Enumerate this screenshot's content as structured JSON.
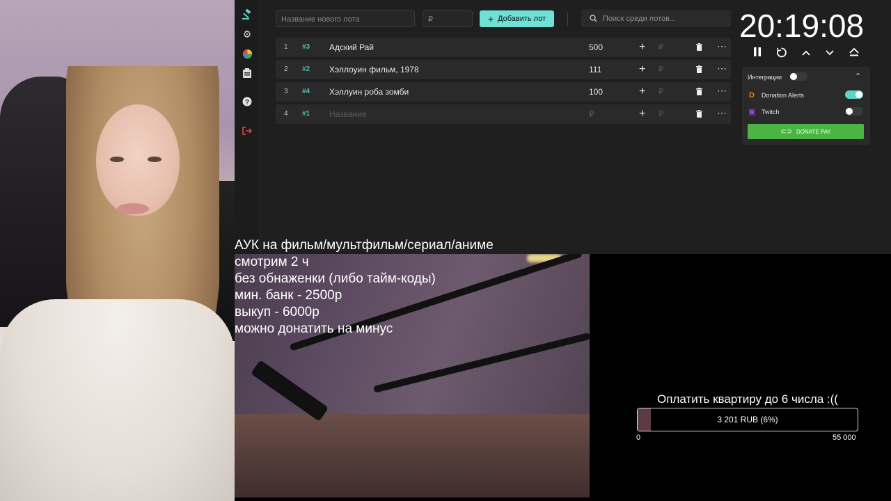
{
  "auction": {
    "new_lot_placeholder": "Название нового лота",
    "amount_placeholder": "₽",
    "add_button": "Добавить лот",
    "search_placeholder": "Поиск среди лотов...",
    "lots": [
      {
        "index": "1",
        "tag": "#3",
        "name": "Адский Рай",
        "amount": "500",
        "rub": "₽"
      },
      {
        "index": "2",
        "tag": "#2",
        "name": "Хэллоуин фильм, 1978",
        "amount": "111",
        "rub": "₽"
      },
      {
        "index": "3",
        "tag": "#4",
        "name": "Хэллуин роба зомби",
        "amount": "100",
        "rub": "₽"
      },
      {
        "index": "4",
        "tag": "#1",
        "name": "Название",
        "amount": "₽",
        "rub": "₽"
      }
    ]
  },
  "timer": {
    "value": "20:19:08"
  },
  "integrations": {
    "title": "Интеграции",
    "donation_alerts": "Donation Alerts",
    "twitch": "Twitch",
    "donate_pay": "DONATE PAY"
  },
  "overlay": {
    "lines": [
      "АУК на фильм/мультфильм/сериал/аниме",
      "смотрим 2 ч",
      "без обнаженки (либо тайм-коды)",
      "мин. банк - 2500р",
      "выкуп - 6000р",
      "можно донатить на минус"
    ]
  },
  "goal": {
    "title": "Оплатить квартиру до 6 числа :((",
    "progress_text": "3 201 RUB (6%)",
    "progress_fraction": 0.06,
    "min": "0",
    "max": "55 000"
  },
  "colors": {
    "accent": "#6ee0d6",
    "donate_pay": "#4bb543",
    "goal_fill": "#5c3c43"
  }
}
